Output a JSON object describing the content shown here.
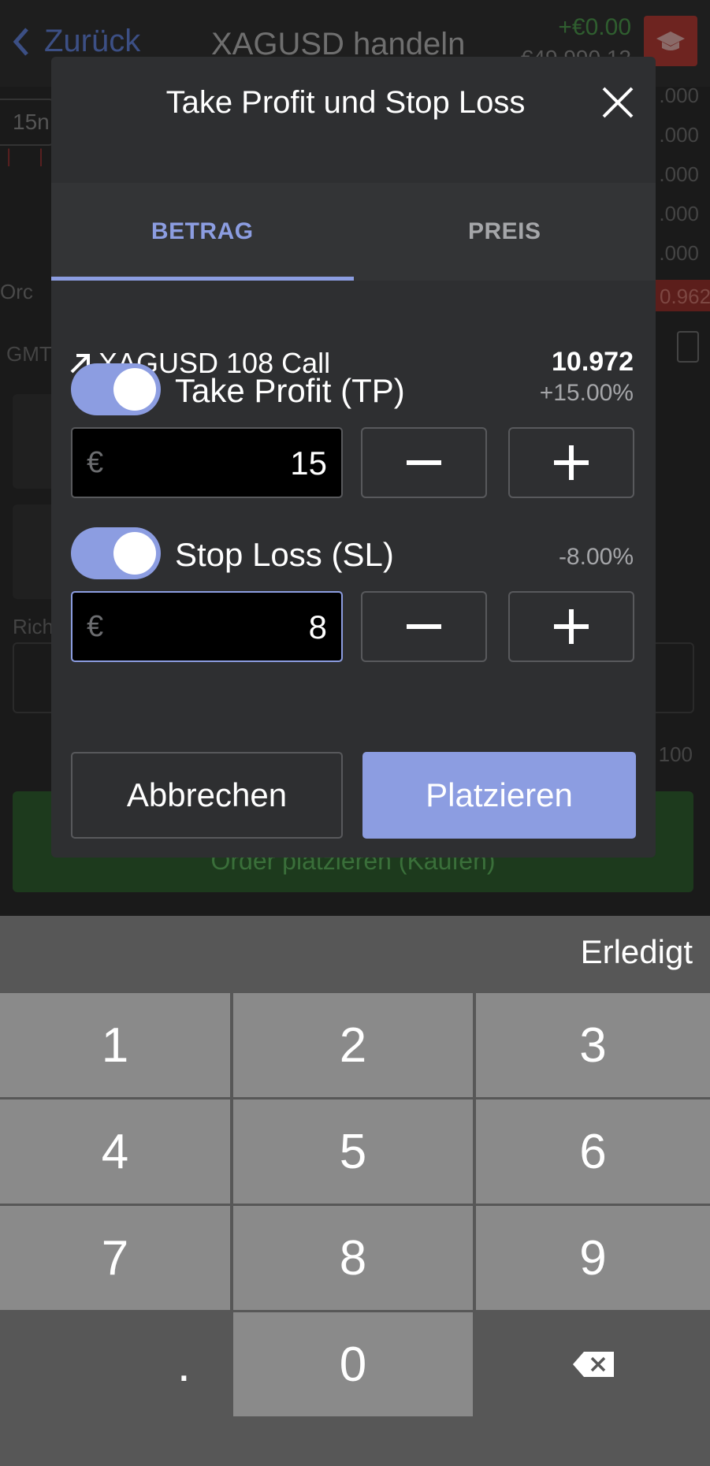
{
  "background": {
    "back_label": "Zurück",
    "title": "XAGUSD handeln",
    "pnl": "+€0.00",
    "balance": "€49,990.12",
    "left_pill": "15n",
    "order_label": "Orc",
    "gmt_label": "GMT",
    "right_axis": [
      ".000",
      ".000",
      ".000",
      ".000",
      ".000"
    ],
    "red_price": "0.962",
    "direction_label": "Rich",
    "right_value": "100",
    "buy_button_label": "Order platzieren (Kaufen)"
  },
  "dialog": {
    "title": "Take Profit und Stop Loss",
    "tabs": [
      {
        "label": "BETRAG",
        "active": true
      },
      {
        "label": "PREIS",
        "active": false
      }
    ],
    "instrument": {
      "name": "XAGUSD 108 Call",
      "value": "10.972"
    },
    "take_profit": {
      "label": "Take Profit (TP)",
      "percent": "+15.00%",
      "currency": "€",
      "value": "15",
      "enabled": true
    },
    "stop_loss": {
      "label": "Stop Loss (SL)",
      "percent": "-8.00%",
      "currency": "€",
      "value": "8",
      "enabled": true
    },
    "cancel_label": "Abbrechen",
    "place_label": "Platzieren"
  },
  "keyboard": {
    "done_label": "Erledigt",
    "keys": [
      "1",
      "2",
      "3",
      "4",
      "5",
      "6",
      "7",
      "8",
      "9",
      ".",
      "0"
    ]
  },
  "colors": {
    "accent": "#8c9de1",
    "dialog_bg": "#2e2f31",
    "keyboard_key": "#8a8a8a"
  }
}
